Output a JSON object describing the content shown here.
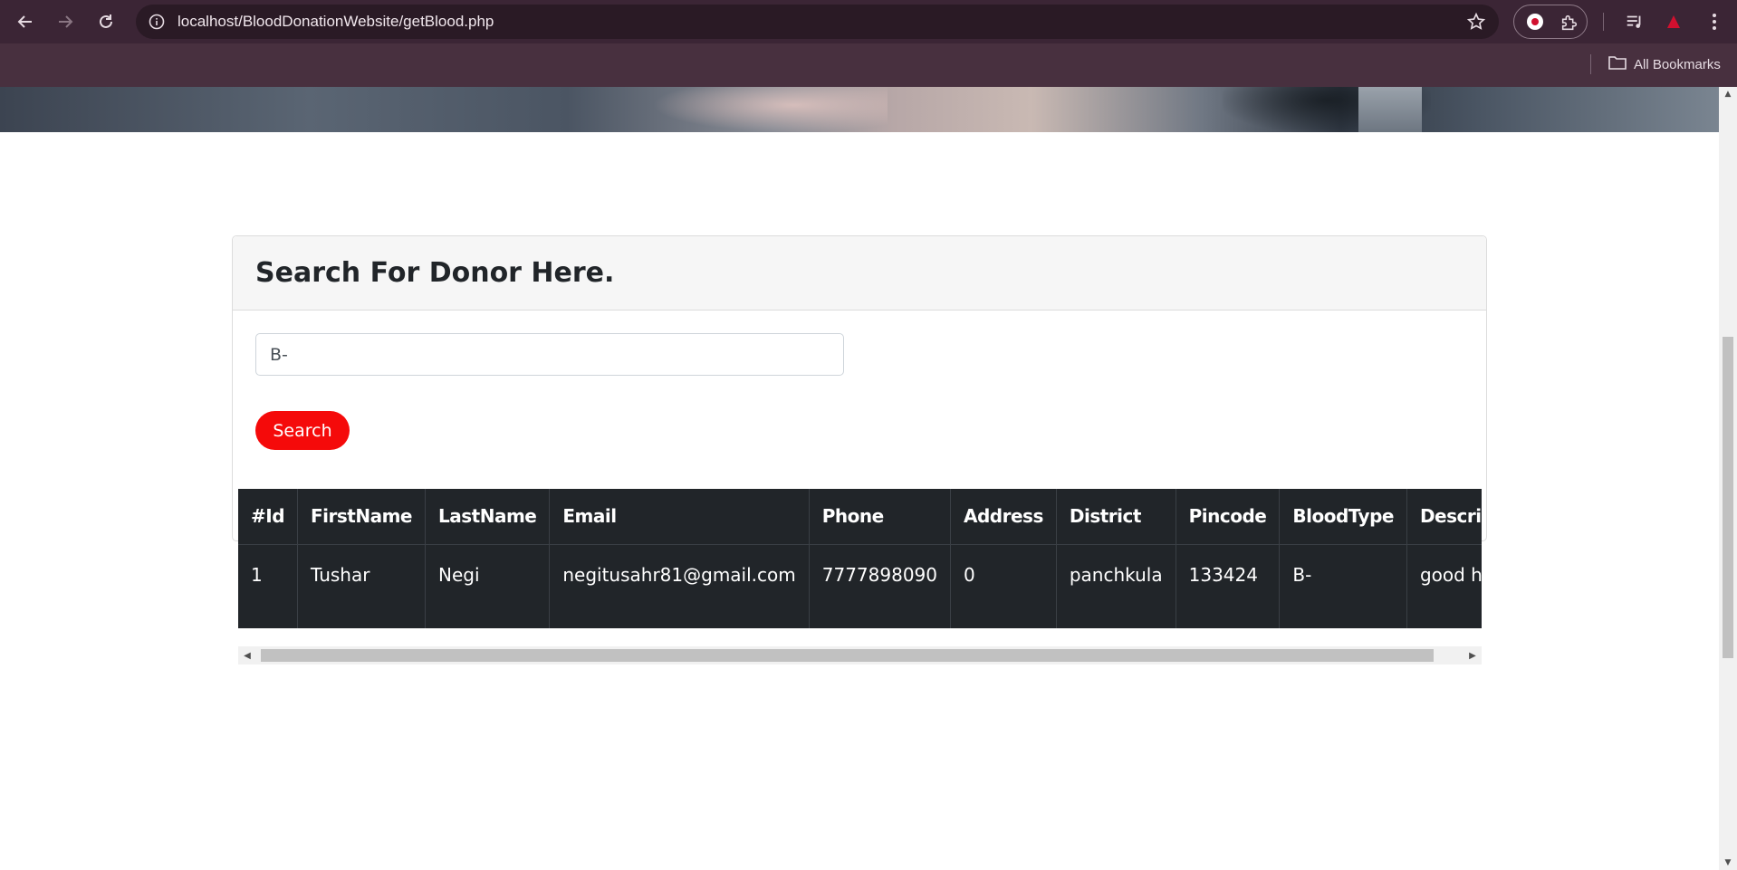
{
  "browser": {
    "url": "localhost/BloodDonationWebsite/getBlood.php",
    "bookmarks_label": "All Bookmarks",
    "icons": [
      "back-icon",
      "forward-icon",
      "reload-icon",
      "site-info-icon",
      "bookmark-star-icon",
      "record-icon",
      "extensions-icon",
      "media-queue-icon",
      "profile-icon",
      "menu-icon",
      "folder-icon"
    ]
  },
  "card": {
    "title": "Search For Donor Here."
  },
  "search": {
    "value": "B-",
    "button_label": "Search"
  },
  "table": {
    "columns": [
      "#Id",
      "FirstName",
      "LastName",
      "Email",
      "Phone",
      "Address",
      "District",
      "Pincode",
      "BloodType",
      "Description"
    ],
    "rows": [
      {
        "id": "1",
        "first_name": "Tushar",
        "last_name": "Negi",
        "email": "negitusahr81@gmail.com",
        "phone": "7777898090",
        "address": "0",
        "district": "panchkula",
        "pincode": "133424",
        "blood_type": "B-",
        "description": "good health"
      }
    ]
  },
  "colors": {
    "chrome_dark": "#3b2535",
    "accent_red": "#f50a0a",
    "table_dark": "#212529"
  }
}
